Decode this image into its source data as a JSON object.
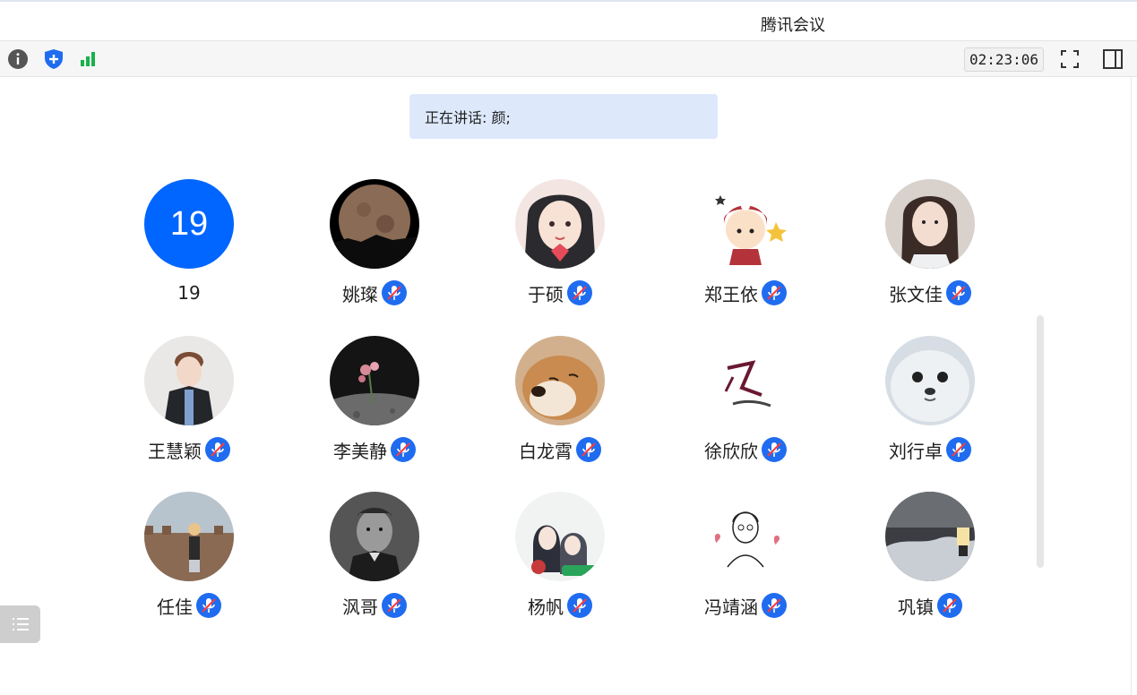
{
  "window": {
    "title": "腾讯会议"
  },
  "toolbar": {
    "icons": [
      "info-icon",
      "shield-icon",
      "signal-icon"
    ],
    "timer": "02:23:06",
    "right_icons": [
      "fullscreen-icon",
      "side-panel-icon"
    ]
  },
  "speaking": {
    "text": "正在讲话: 颜;"
  },
  "participants": [
    {
      "name": "19",
      "avatar": "number-avatar",
      "avatar_text": "19",
      "muted_icon": false
    },
    {
      "name": "姚璨",
      "avatar": "moon-avatar",
      "muted_icon": true
    },
    {
      "name": "于硕",
      "avatar": "anime-girl-avatar",
      "muted_icon": true
    },
    {
      "name": "郑王依",
      "avatar": "cartoon-girl-avatar",
      "muted_icon": true
    },
    {
      "name": "张文佳",
      "avatar": "girl-photo-avatar",
      "muted_icon": true
    },
    {
      "name": "王慧颖",
      "avatar": "boy-photo-avatar",
      "muted_icon": true
    },
    {
      "name": "李美静",
      "avatar": "flower-moon-avatar",
      "muted_icon": true
    },
    {
      "name": "白龙霄",
      "avatar": "shiba-avatar",
      "muted_icon": true
    },
    {
      "name": "徐欣欣",
      "avatar": "calligraphy-avatar",
      "muted_icon": true
    },
    {
      "name": "刘行卓",
      "avatar": "seal-avatar",
      "muted_icon": true
    },
    {
      "name": "任佳",
      "avatar": "great-wall-avatar",
      "muted_icon": true
    },
    {
      "name": "沨哥",
      "avatar": "portrait-avatar",
      "muted_icon": true
    },
    {
      "name": "杨帆",
      "avatar": "anime-couple-avatar",
      "muted_icon": true
    },
    {
      "name": "冯靖涵",
      "avatar": "sketch-avatar",
      "muted_icon": true
    },
    {
      "name": "巩镇",
      "avatar": "snow-lamp-avatar",
      "muted_icon": true
    }
  ],
  "colors": {
    "accent": "#0066ff",
    "mic_badge": "#1f6cf0",
    "speaking_bg": "#dde9fb"
  }
}
